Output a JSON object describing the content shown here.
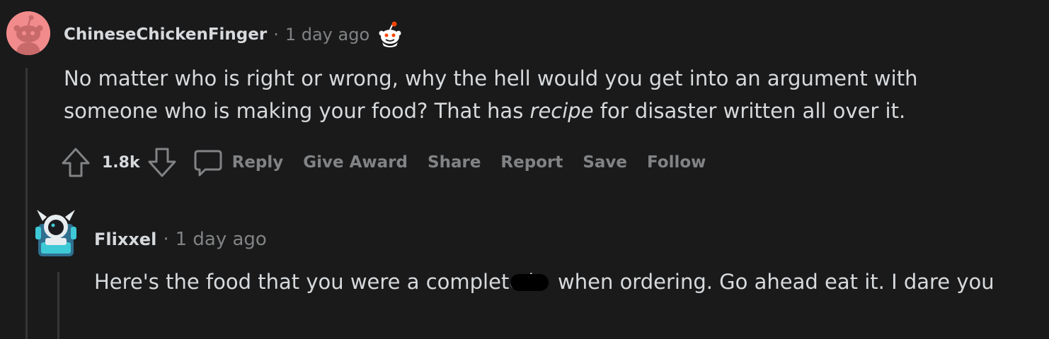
{
  "comment": {
    "username": "ChineseChickenFinger",
    "separator": "·",
    "time": "1 day ago",
    "award_icon": "snoo-award-icon",
    "body_before": "No matter who is right or wrong, why the hell would you get into an argument with someone who is making your food? That has ",
    "body_em": "recipe",
    "body_after": " for disaster written all over it.",
    "score": "1.8k",
    "actions": {
      "reply": "Reply",
      "give_award": "Give Award",
      "share": "Share",
      "report": "Report",
      "save": "Save",
      "follow": "Follow"
    }
  },
  "reply": {
    "username": "Flixxel",
    "separator": "·",
    "time": "1 day ago",
    "body_before": "Here's the food that you were a complete b",
    "body_after": " when ordering. Go ahead eat it. I dare you"
  },
  "colors": {
    "background": "#1a1a1b",
    "text": "#d7dadc",
    "muted": "#818384",
    "avatar_bg": "#f28b8b"
  }
}
